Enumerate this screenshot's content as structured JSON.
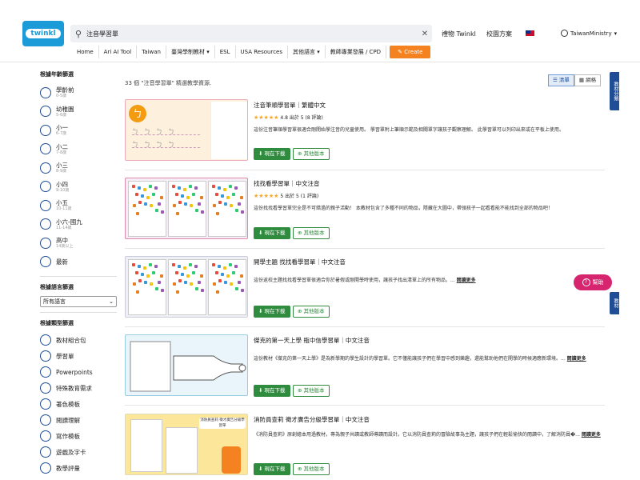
{
  "header": {
    "logo_text": "twinkl",
    "search_value": "注音學習單",
    "gift_link": "禮物 Twinkl",
    "school_plan_link": "校園方案",
    "account_name": "TaiwanMinistry"
  },
  "nav": {
    "items": [
      "Home",
      "Ari AI Tool",
      "Taiwan",
      "臺灣學制教材 ▾",
      "ESL",
      "USA Resources",
      "其他語言 ▾",
      "教師專業發展 / CPD"
    ],
    "create_label": "Create"
  },
  "sidebar": {
    "age_title": "根據年齡篩選",
    "ages": [
      {
        "label": "學齡前",
        "sub": "0-5歲"
      },
      {
        "label": "幼稚園",
        "sub": "5-6歲"
      },
      {
        "label": "小一",
        "sub": "6-7歲"
      },
      {
        "label": "小二",
        "sub": "7-8歲"
      },
      {
        "label": "小三",
        "sub": "8-9歲"
      },
      {
        "label": "小四",
        "sub": "9-10歲"
      },
      {
        "label": "小五",
        "sub": "10-11歲"
      },
      {
        "label": "小六-國九",
        "sub": "11-14歲"
      },
      {
        "label": "高中",
        "sub": "14歲以上"
      },
      {
        "label": "最新",
        "sub": ""
      }
    ],
    "language_title": "根據語言篩選",
    "language_value": "所有語言",
    "type_title": "根據類型篩選",
    "types": [
      "教材組合包",
      "學習單",
      "Powerpoints",
      "特殊教育需求",
      "著色模板",
      "閱讀理解",
      "寫作模板",
      "遊戲及字卡",
      "教學評量"
    ]
  },
  "results": {
    "count_text": "33 個 \"注音學習單\" 精選教學資源.",
    "view_list": "清單",
    "view_grid": "網格",
    "download_label": "現在下載",
    "other_label": "其他版本",
    "more_label": "閱讀更多",
    "items": [
      {
        "title": "注音筆順學習單｜繁體中文",
        "rating_text": "4.8 出於 5 (8 評論)",
        "stars": "★★★★★",
        "desc": "這份注音筆順學習單很適合剛開始學注音的兒童使用。 學習單附上筆順示範及相關單字讓孩子觀察理解。 此學習單可以列印出來或在平板上使用。",
        "has_more": false
      },
      {
        "title": "找找看學習單｜中文注音",
        "rating_text": "5 出於 5 (1 評論)",
        "stars": "★★★★★",
        "desc": "這份找找看學習單完全是不可錯過的親子活動！ 本教材包含了多種不同的物品，隱藏在大圖中，帶領孩子一起看看能不能找到全部的物品吧！",
        "has_more": false
      },
      {
        "title": "開學主題 找找看學習單｜中文注音",
        "rating_text": "",
        "stars": "",
        "desc": "這份返校主題找找看學習單很適合你於暑假或剛開學時使用，讓孩子找出清單上的所有物品，...",
        "has_more": true
      },
      {
        "title": "傑克的第一天上學 瓶中信學習單｜中文注音",
        "rating_text": "",
        "stars": "",
        "desc": "這份教材《傑克的第一天上學》是為新學期的學生設計的學習單。它不僅能讓孩子們在學習中感到樂趣，還能幫助他們在開學的時候適應新環境。...",
        "has_more": true
      },
      {
        "title": "消防員查莉 徵才廣告分級學習單｜中文注音",
        "rating_text": "",
        "stars": "",
        "desc": "《消防員查莉》原創繪本用過教材，專為親子共讀或教師導讀而設計。它以消防員查莉的冒險故事為主題，讓孩子們在輕鬆愉快的閱讀中，了解消防員�...",
        "has_more": true
      }
    ]
  },
  "right_tabs": {
    "tab1": "教材分類",
    "tab2": "教材",
    "help_label": "幫助"
  },
  "thumb_text": {
    "t5_title": "消防員查莉 徵才廣告分級學習單"
  }
}
